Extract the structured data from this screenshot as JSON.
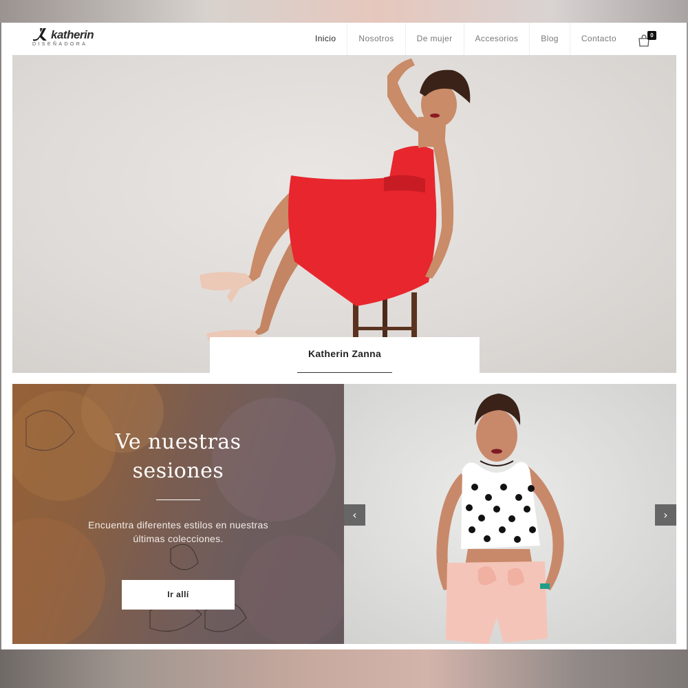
{
  "brand": {
    "name": "katherin",
    "tagline": "DISEÑADORA"
  },
  "nav": {
    "items": [
      {
        "label": "Inicio",
        "active": true
      },
      {
        "label": "Nosotros",
        "active": false
      },
      {
        "label": "De mujer",
        "active": false
      },
      {
        "label": "Accesorios",
        "active": false
      },
      {
        "label": "Blog",
        "active": false
      },
      {
        "label": "Contacto",
        "active": false
      }
    ]
  },
  "cart": {
    "count": "0",
    "icon": "shopping-bag-icon"
  },
  "hero": {
    "caption": "Katherin Zanna"
  },
  "sessions": {
    "title_line1": "Ve nuestras",
    "title_line2": "sesiones",
    "description_line1": "Encuentra diferentes estilos en nuestras",
    "description_line2": "últimas colecciones.",
    "button_label": "Ir allí"
  },
  "carousel": {
    "prev_icon": "chevron-left-icon",
    "next_icon": "chevron-right-icon",
    "prev_glyph": "‹",
    "next_glyph": "›"
  },
  "colors": {
    "dress_red": "#e8262e",
    "accent_black": "#111111",
    "shorts_pink": "#f5c4b8"
  }
}
